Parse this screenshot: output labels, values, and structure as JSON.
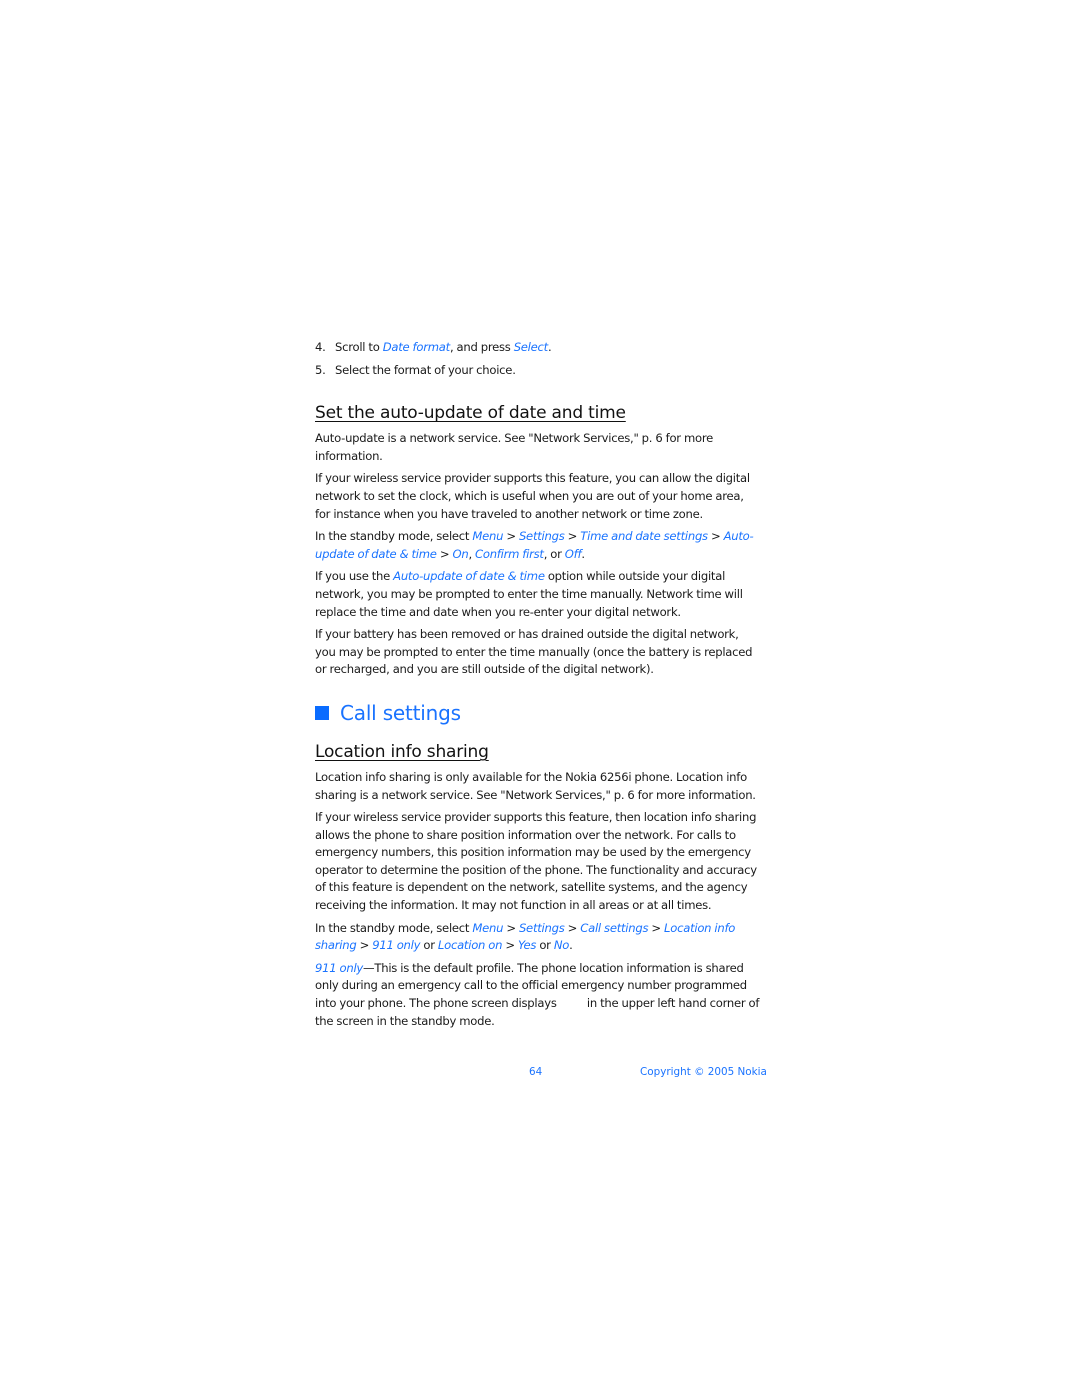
{
  "steps": [
    {
      "num": "4.",
      "pre": "Scroll to ",
      "link1": "Date format",
      "mid": ", and press ",
      "link2": "Select",
      "post": "."
    },
    {
      "num": "5.",
      "text": "Select the format of your choice."
    }
  ],
  "section_auto_update": {
    "heading": "Set the auto-update of date and time",
    "p1": "Auto-update is a network service. See \"Network Services,\" p. 6 for more information.",
    "p2": "If your wireless service provider supports this feature, you can allow the digital network to set the clock, which is useful when you are out of your home area, for instance when you have traveled to another network or time zone.",
    "p3": {
      "pre": "In the standby mode, select ",
      "menu": "Menu",
      "sep1": " > ",
      "settings": "Settings",
      "sep2": " > ",
      "time_date": "Time and date settings",
      "sep3": " > ",
      "auto_update": "Auto-update of date & time",
      "sep4": " > ",
      "on": "On",
      "comma": ", ",
      "confirm": "Confirm first",
      "or": ", or ",
      "off": "Off",
      "end": "."
    },
    "p4": {
      "pre": "If you use the ",
      "link": "Auto-update of date & time",
      "post": " option while outside your digital network, you may be prompted to enter the time manually. Network time will replace the time and date when you re-enter your digital network."
    },
    "p5": "If your battery has been removed or has drained outside the digital network, you may be prompted to enter the time manually (once the battery is replaced or recharged, and you are still outside of the digital network)."
  },
  "section_call_settings": {
    "title": "Call settings",
    "subheading": "Location info sharing",
    "p1": "Location info sharing is only available for the Nokia 6256i phone. Location info sharing is a network service. See \"Network Services,\" p. 6 for more information.",
    "p2": "If your wireless service provider supports this feature, then location info sharing allows the phone to share position information over the network. For calls to emergency numbers, this position information may be used by the emergency operator to determine the position of the phone. The functionality and accuracy of this feature is dependent on the network, satellite systems, and the agency receiving the information. It may not function in all areas or at all times.",
    "p3": {
      "pre": "In the standby mode, select ",
      "menu": "Menu",
      "sep1": " > ",
      "settings": "Settings",
      "sep2": " > ",
      "call_settings": "Call settings",
      "sep3": " > ",
      "location_sharing": "Location info sharing",
      "sep4": " > ",
      "only911": "911 only",
      "or1": " or ",
      "location_on": "Location on",
      "sep5": " > ",
      "yes": "Yes",
      "or2": " or ",
      "no": "No",
      "end": "."
    },
    "p4": {
      "link": "911 only",
      "pre": "—This is the default profile. The phone location information is shared only during an emergency call to the official emergency number programmed into your phone. The phone screen displays ",
      "post": " in the upper left hand corner of the screen in the standby mode."
    }
  },
  "footer": {
    "page_number": "64",
    "copyright": "Copyright © 2005 Nokia"
  },
  "colors": {
    "link": "#1a73ff",
    "heading_square": "#0a6cff",
    "text": "#1a1a1a"
  }
}
